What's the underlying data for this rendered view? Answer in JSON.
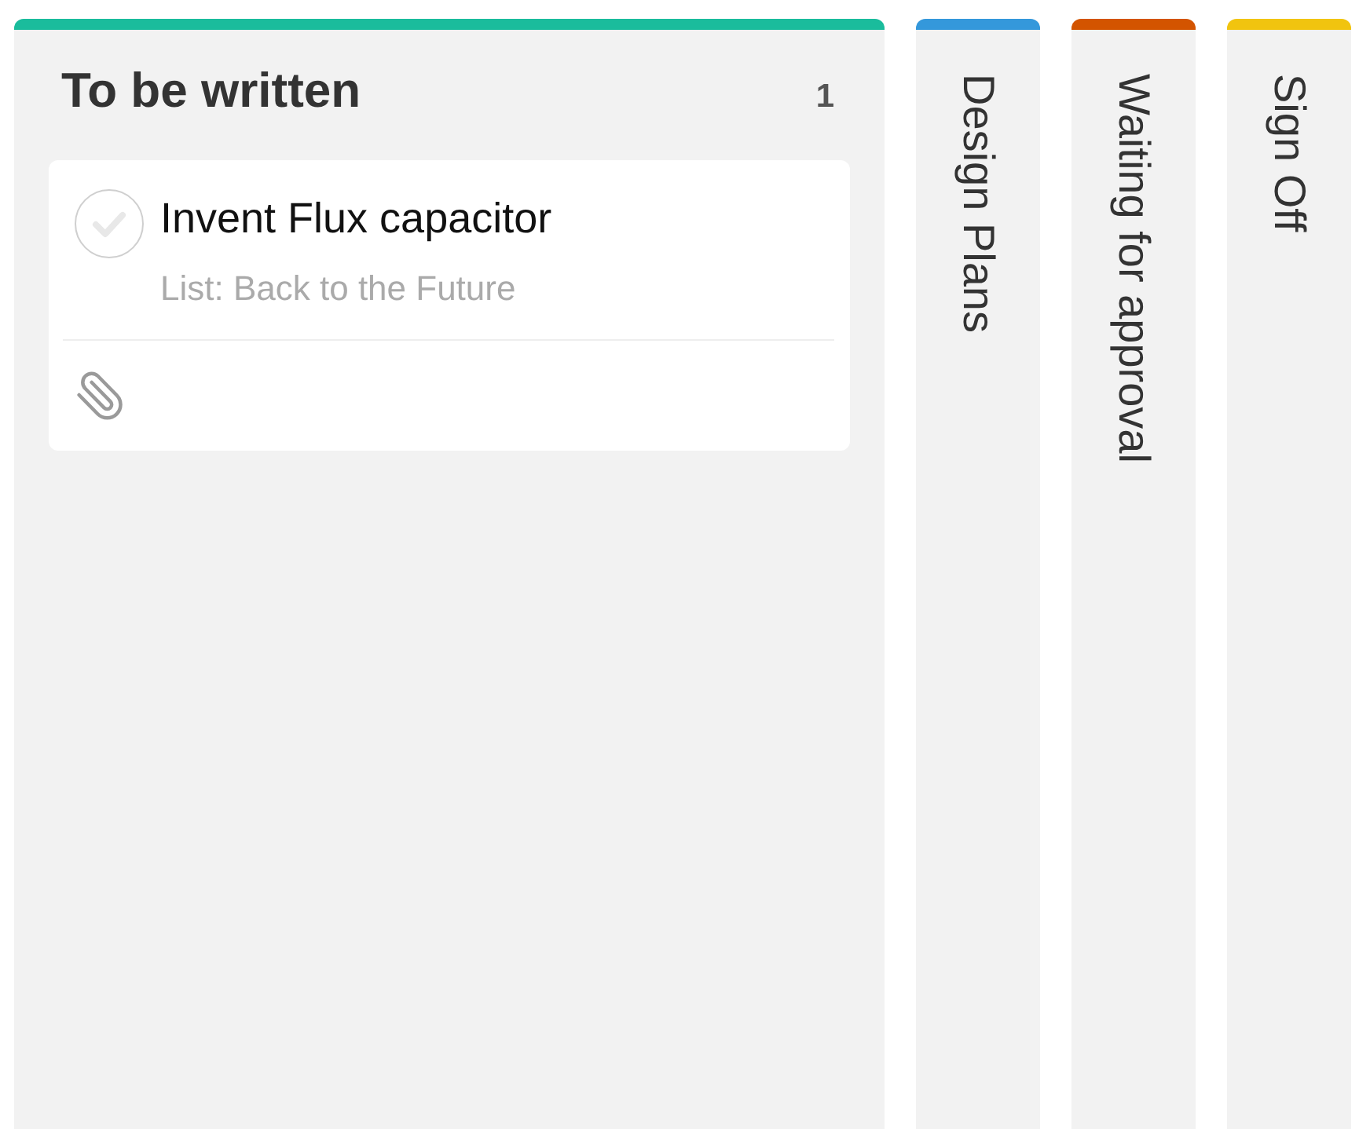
{
  "columns": [
    {
      "kind": "expanded",
      "title": "To be written",
      "count": "1",
      "color": "#1abc9c",
      "cards": [
        {
          "title": "Invent Flux capacitor",
          "list": "List: Back to the Future",
          "completed": false,
          "attachment": true
        }
      ]
    },
    {
      "kind": "collapsed",
      "title": "Design Plans",
      "color": "#3498db"
    },
    {
      "kind": "collapsed",
      "title": "Waiting for approval",
      "color": "#d35400"
    },
    {
      "kind": "collapsed",
      "title": "Sign Off",
      "color": "#f1c40f"
    }
  ]
}
